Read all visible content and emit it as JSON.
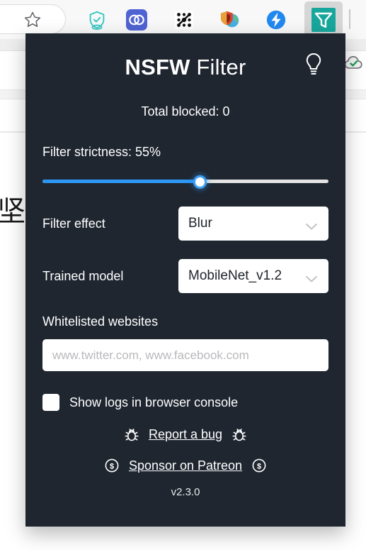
{
  "browser": {
    "toolbar": {
      "bookmark_star": "star-icon",
      "extensions": [
        {
          "name": "shield-check-extension-icon",
          "color": "#35c6c0"
        },
        {
          "name": "linked-rings-extension-icon",
          "color": "#4f63d2"
        },
        {
          "name": "node-graph-extension-icon",
          "color": "#111111"
        },
        {
          "name": "globe-shield-extension-icon",
          "color": "#3aa5d8"
        },
        {
          "name": "lightning-bolt-extension-icon",
          "color": "#2188f0"
        },
        {
          "name": "nsfw-filter-funnel-icon",
          "color": "#17a79c"
        }
      ]
    },
    "page": {
      "visible_character": "坚",
      "cloud_sync_icon": "cloud-check-icon"
    }
  },
  "popup": {
    "title_bold": "NSFW",
    "title_light": " Filter",
    "bulb_icon": "lightbulb-icon",
    "total_blocked": "Total blocked: 0",
    "strictness": {
      "label": "Filter strictness: 55%",
      "value": 55,
      "min": 0,
      "max": 100,
      "fill_color": "#2d96f3",
      "track_color": "#e3e3e3"
    },
    "filter_effect": {
      "label": "Filter effect",
      "value": "Blur"
    },
    "trained_model": {
      "label": "Trained model",
      "value": "MobileNet_v1.2"
    },
    "whitelist": {
      "label": "Whitelisted websites",
      "value": "",
      "placeholder": "www.twitter.com, www.facebook.com"
    },
    "show_logs": {
      "label": "Show logs in browser console",
      "checked": false
    },
    "report_bug": {
      "label": "Report a bug",
      "icon": "bug-icon"
    },
    "sponsor": {
      "label": "Sponsor on Patreon",
      "icon": "dollar-circle-icon"
    },
    "version": "v2.3.0",
    "background_color": "#1f2630"
  }
}
